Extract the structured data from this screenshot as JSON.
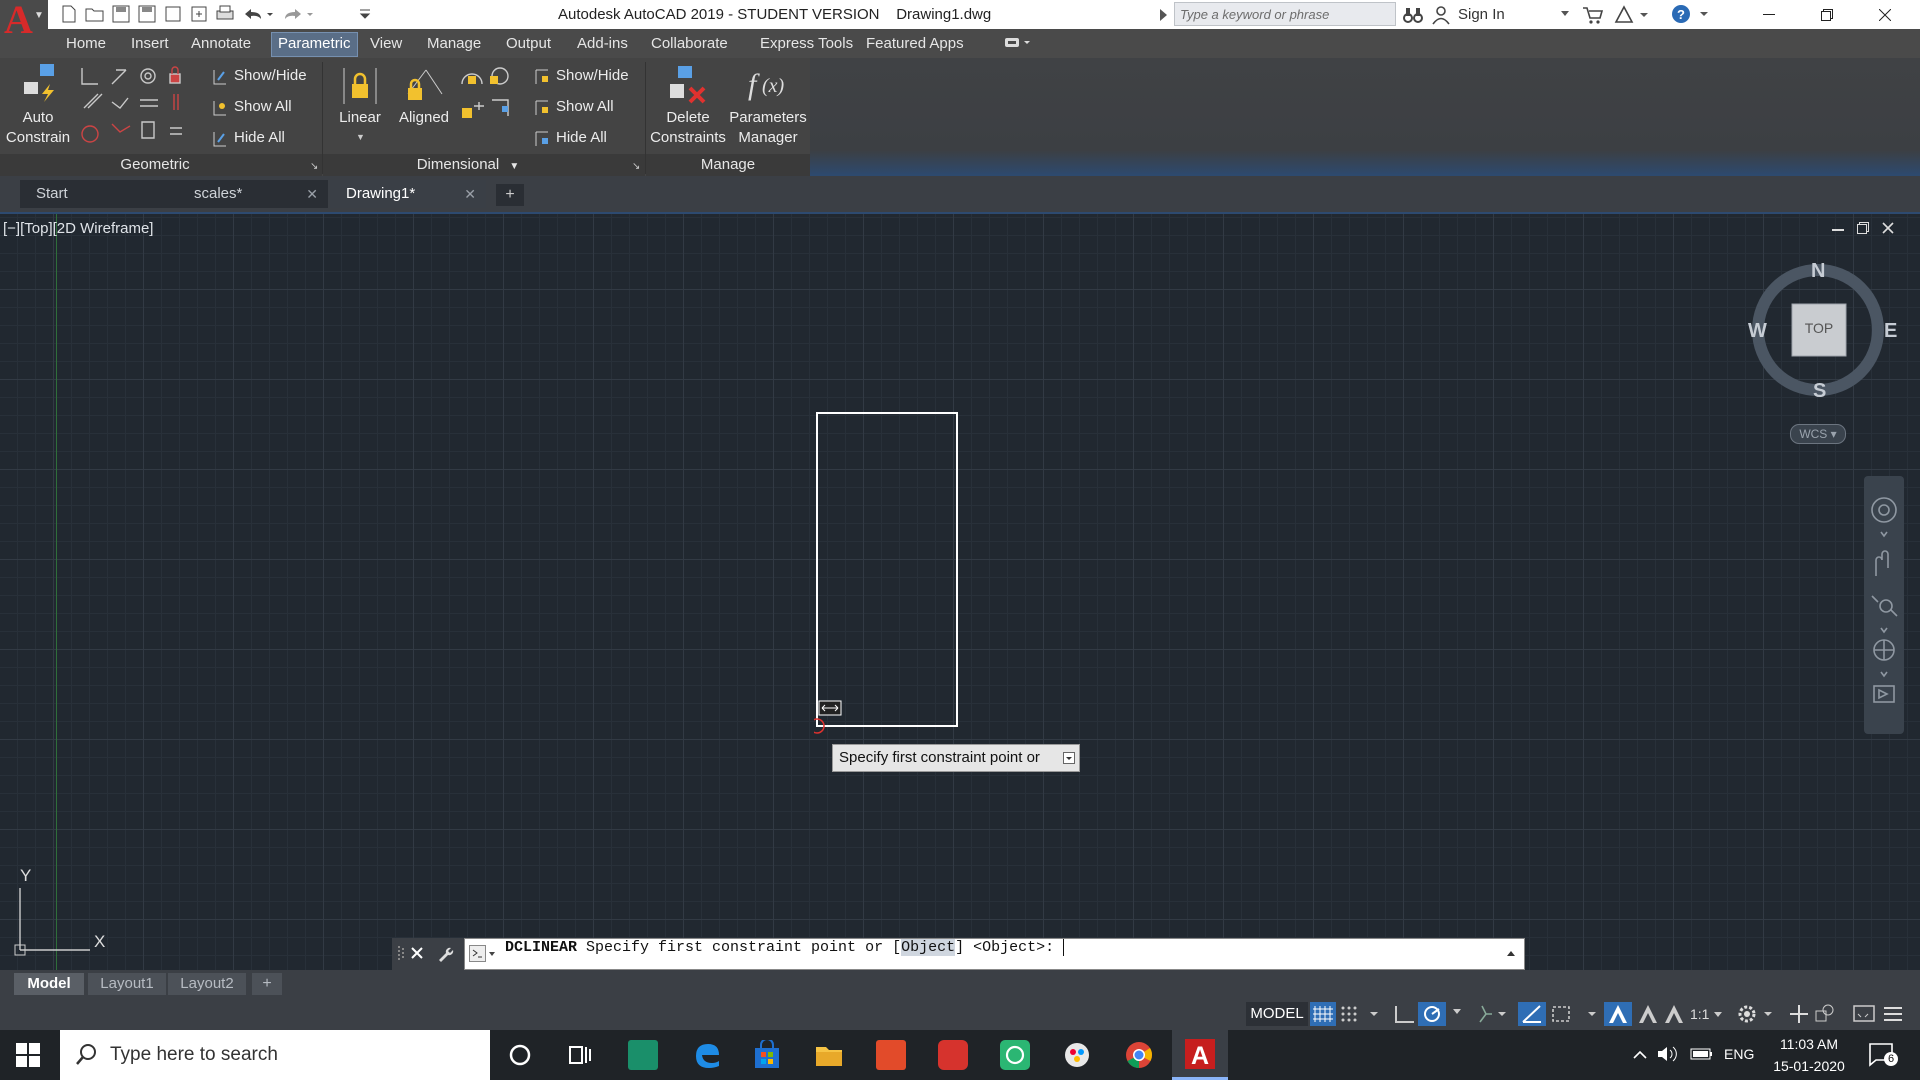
{
  "app": {
    "title": "Autodesk AutoCAD 2019 - STUDENT VERSION    Drawing1.dwg",
    "logo_letter": "A",
    "search_placeholder": "Type a keyword or phrase",
    "sign_in": "Sign In"
  },
  "ribbon_tabs": [
    "Home",
    "Insert",
    "Annotate",
    "Parametric",
    "View",
    "Manage",
    "Output",
    "Add-ins",
    "Collaborate",
    "Express Tools",
    "Featured Apps"
  ],
  "active_ribbon_tab": "Parametric",
  "ribbon": {
    "auto_constrain": "Auto\nConstrain",
    "auto_constrain_l1": "Auto",
    "auto_constrain_l2": "Constrain",
    "geo_show_hide": "Show/Hide",
    "geo_show_all": "Show All",
    "geo_hide_all": "Hide All",
    "geometric_panel": "Geometric",
    "linear": "Linear",
    "aligned": "Aligned",
    "dim_show_hide": "Show/Hide",
    "dim_show_all": "Show All",
    "dim_hide_all": "Hide All",
    "dimensional_panel": "Dimensional",
    "delete_l1": "Delete",
    "delete_l2": "Constraints",
    "params_l1": "Parameters",
    "params_l2": "Manager",
    "manage_panel": "Manage"
  },
  "doc_tabs": [
    {
      "label": "Start",
      "active": false
    },
    {
      "label": "scales*",
      "active": false
    },
    {
      "label": "Drawing1*",
      "active": true
    }
  ],
  "viewport": {
    "label": "[−][Top][2D Wireframe]"
  },
  "viewcube": {
    "north": "N",
    "south": "S",
    "east": "E",
    "west": "W",
    "face": "TOP",
    "wcs": "WCS"
  },
  "ucs": {
    "x": "X",
    "y": "Y"
  },
  "tooltip": "Specify first constraint point or",
  "command": {
    "name": "DCLINEAR",
    "text_before": " Specify first constraint point or [",
    "option": "Object",
    "text_after": "] <Object>: "
  },
  "layout_tabs": [
    {
      "label": "Model",
      "active": true
    },
    {
      "label": "Layout1",
      "active": false
    },
    {
      "label": "Layout2",
      "active": false
    }
  ],
  "status": {
    "model": "MODEL",
    "scale": "1:1"
  },
  "taskbar": {
    "search_placeholder": "Type here to search",
    "language": "ENG",
    "time": "11:03 AM",
    "date": "15-01-2020",
    "notifications": "6"
  },
  "colors": {
    "canvas": "#212830",
    "accent": "#5a6e87",
    "logo_red": "#d72a2a"
  }
}
